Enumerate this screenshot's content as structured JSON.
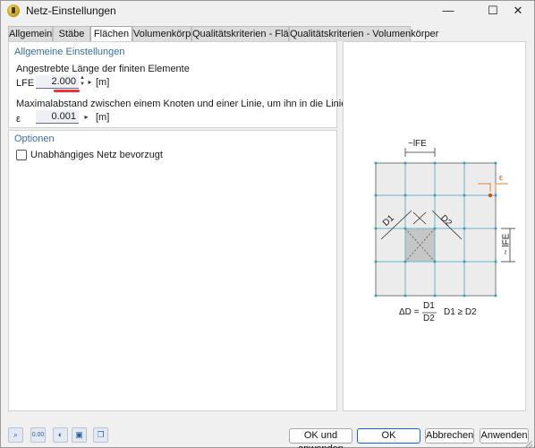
{
  "window": {
    "title": "Netz-Einstellungen"
  },
  "titlebar": {
    "minimize": "—",
    "maximize": "☐",
    "close": "✕"
  },
  "tabs": [
    {
      "label": "Allgemein"
    },
    {
      "label": "Stäbe"
    },
    {
      "label": "Flächen"
    },
    {
      "label": "Volumenkörper"
    },
    {
      "label": "Qualitätskriterien - Flächen"
    },
    {
      "label": "Qualitätskriterien - Volumenkörper"
    }
  ],
  "active_tab": "Flächen",
  "general": {
    "heading": "Allgemeine Einstellungen",
    "target_length_label": "Angestrebte Länge der finiten Elemente",
    "lfe_symbol": "LFE",
    "lfe_value": "2.000",
    "lfe_unit": "[m]",
    "max_distance_label": "Maximalabstand zwischen einem Knoten und einer Linie, um ihn in die Linie zu integrieren",
    "epsilon_symbol": "ε",
    "epsilon_value": "0.001",
    "epsilon_unit": "[m]"
  },
  "options": {
    "heading": "Optionen",
    "independent_mesh_label": "Unabhängiges Netz bevorzugt",
    "independent_mesh_checked": false
  },
  "diagram": {
    "lfe_top_label": "~lFE",
    "lfe_side_label": "~ lFE",
    "epsilon_label": "ε",
    "d1_label": "D1",
    "d2_label": "D2",
    "formula_lhs": "ΔD =",
    "formula_num": "D1",
    "formula_den": "D2",
    "formula_cond": "D1 ≥ D2"
  },
  "buttons": {
    "ok_apply": "OK und anwenden",
    "ok": "OK",
    "cancel": "Abbrechen",
    "apply": "Anwenden"
  },
  "toolbar": [
    {
      "icon": "search-icon"
    },
    {
      "icon": "units-icon",
      "text": "0.00"
    },
    {
      "icon": "display-icon"
    },
    {
      "icon": "save-icon"
    },
    {
      "icon": "copy-icon"
    }
  ]
}
